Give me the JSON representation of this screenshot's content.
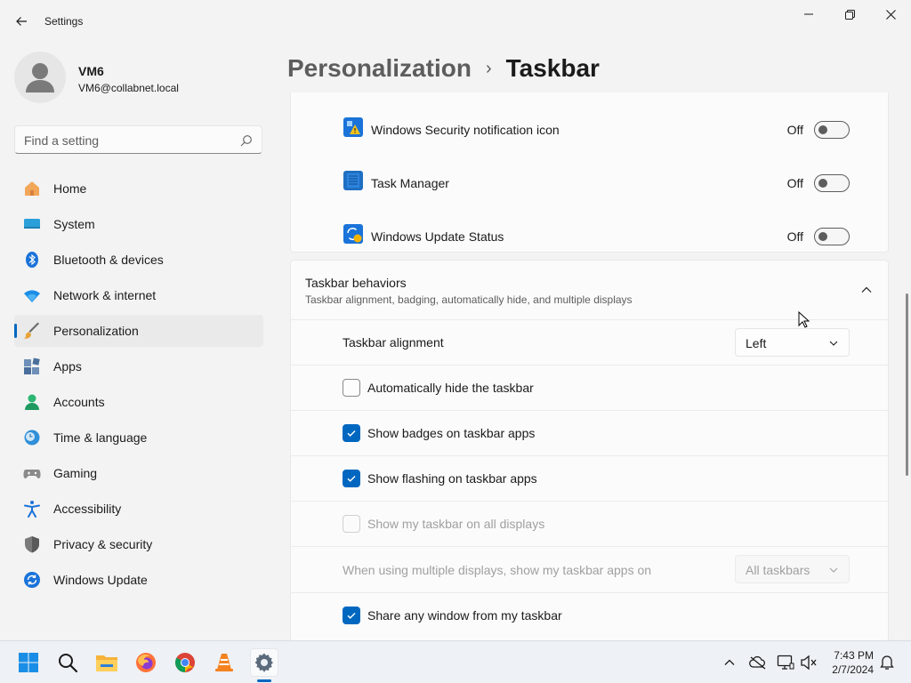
{
  "window": {
    "title": "Settings",
    "minimize_icon": "minimize-icon",
    "maximize_icon": "restore-icon",
    "close_icon": "close-icon"
  },
  "profile": {
    "name": "VM6",
    "email": "VM6@collabnet.local"
  },
  "search": {
    "placeholder": "Find a setting"
  },
  "sidebar": {
    "items": [
      {
        "label": "Home",
        "icon": "home-icon"
      },
      {
        "label": "System",
        "icon": "system-icon"
      },
      {
        "label": "Bluetooth & devices",
        "icon": "bluetooth-icon"
      },
      {
        "label": "Network & internet",
        "icon": "wifi-icon"
      },
      {
        "label": "Personalization",
        "icon": "brush-icon",
        "selected": true
      },
      {
        "label": "Apps",
        "icon": "apps-icon"
      },
      {
        "label": "Accounts",
        "icon": "accounts-icon"
      },
      {
        "label": "Time & language",
        "icon": "clock-globe-icon"
      },
      {
        "label": "Gaming",
        "icon": "gamepad-icon"
      },
      {
        "label": "Accessibility",
        "icon": "accessibility-icon"
      },
      {
        "label": "Privacy & security",
        "icon": "shield-icon"
      },
      {
        "label": "Windows Update",
        "icon": "update-icon"
      }
    ]
  },
  "header": {
    "parent": "Personalization",
    "separator": "›",
    "current": "Taskbar"
  },
  "tray_apps": [
    {
      "label": "Windows Security notification icon",
      "state": "Off",
      "on": false,
      "icon": "windows-security-icon"
    },
    {
      "label": "Task Manager",
      "state": "Off",
      "on": false,
      "icon": "task-manager-icon"
    },
    {
      "label": "Windows Update Status",
      "state": "Off",
      "on": false,
      "icon": "windows-update-status-icon"
    }
  ],
  "behaviors": {
    "title": "Taskbar behaviors",
    "subtitle": "Taskbar alignment, badging, automatically hide, and multiple displays",
    "expanded": true,
    "alignment": {
      "label": "Taskbar alignment",
      "value": "Left"
    },
    "options": [
      {
        "label": "Automatically hide the taskbar",
        "checked": false,
        "disabled": false
      },
      {
        "label": "Show badges on taskbar apps",
        "checked": true,
        "disabled": false
      },
      {
        "label": "Show flashing on taskbar apps",
        "checked": true,
        "disabled": false
      },
      {
        "label": "Show my taskbar on all displays",
        "checked": false,
        "disabled": true
      }
    ],
    "multi_display": {
      "label": "When using multiple displays, show my taskbar apps on",
      "value": "All taskbars",
      "disabled": true
    },
    "share_window": {
      "label": "Share any window from my taskbar",
      "checked": true
    }
  },
  "taskbar": {
    "apps": [
      "start-icon",
      "search-icon",
      "file-explorer-icon",
      "firefox-icon",
      "chrome-icon",
      "vlc-icon",
      "settings-icon"
    ],
    "active_app": "settings-icon",
    "tray": [
      "chevron-up-icon",
      "onedrive-offline-icon",
      "network-icon",
      "volume-icon",
      "notifications-icon"
    ],
    "time": "7:43 PM",
    "date": "2/7/2024"
  },
  "colors": {
    "accent": "#0067c0",
    "background": "#f3f3f3",
    "card": "#fbfbfb"
  }
}
